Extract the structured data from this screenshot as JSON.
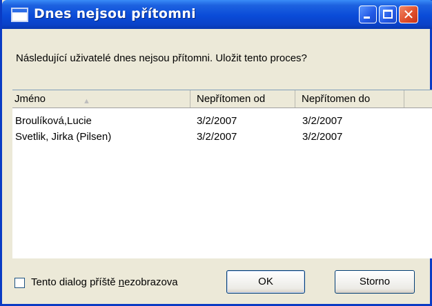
{
  "window": {
    "title": "Dnes nejsou přítomni",
    "close_glyph": "✕"
  },
  "message": "Následující uživatelé dnes nejsou přítomni. Uložit tento proces?",
  "list": {
    "columns": [
      "Jméno",
      "Nepřítomen od",
      "Nepřítomen do"
    ],
    "sort_column": "Jméno",
    "sort_direction": "ascending",
    "rows": [
      {
        "name": "Broulíková,Lucie",
        "from": "3/2/2007",
        "to": "3/2/2007"
      },
      {
        "name": "Svetlik, Jirka (Pilsen)",
        "from": "3/2/2007",
        "to": "3/2/2007"
      }
    ]
  },
  "footer": {
    "checkbox_prefix": "Tento dialog příště ",
    "checkbox_mnemonic": "n",
    "checkbox_suffix": "ezobrazova",
    "checkbox_checked": false,
    "ok_label": "OK",
    "cancel_label": "Storno"
  }
}
